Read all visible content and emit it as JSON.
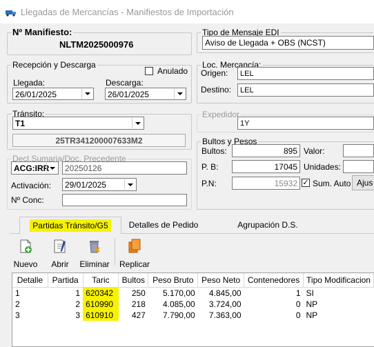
{
  "window": {
    "title": "Llegadas de Mercancías - Manifiestos de Importación"
  },
  "manifest": {
    "label": "Nº Manifiesto:",
    "value": "NLTM2025000976"
  },
  "edi": {
    "label": "Tipo de Mensaje EDI",
    "value": "Aviso de Llegada + OBS (NCST)"
  },
  "reception": {
    "label": "Recepción y Descarga",
    "anulado_label": "Anulado",
    "llegada_label": "Llegada:",
    "llegada_value": "26/01/2025",
    "descarga_label": "Descarga:",
    "descarga_value": "26/01/2025"
  },
  "loc": {
    "label": "Loc. Mercancía:",
    "origen_label": "Origen:",
    "origen_value": "LEL",
    "destino_label": "Destino:",
    "destino_value": "LEL"
  },
  "transito": {
    "label": "Tránsito:",
    "type_value": "T1",
    "code_value": "25TR341200007633M2"
  },
  "expedidor": {
    "label": "Expedidor",
    "value": "1Y"
  },
  "decl": {
    "label": "Decl.Sumaria/Doc. Precedente",
    "type_value": "ACG:IRR",
    "number_value": "20250126",
    "activacion_label": "Activación:",
    "activacion_value": "29/01/2025",
    "conc_label": "Nº Conc:",
    "conc_value": ""
  },
  "bultos": {
    "label": "Bultos y Pesos",
    "bultos_label": "Bultos:",
    "bultos_value": "895",
    "pb_label": "P. B:",
    "pb_value": "17045",
    "pn_label": "P.N:",
    "pn_value": "15932",
    "valor_label": "Valor:",
    "unidades_label": "Unidades:",
    "sum_auto_label": "Sum. Auto",
    "ajus_label": "Ajus"
  },
  "tabs": [
    "Partidas Tránsito/G5",
    "Detalles de Pedido",
    "Agrupación D.S."
  ],
  "toolbar": {
    "nuevo": "Nuevo",
    "abrir": "Abrir",
    "eliminar": "Eliminar",
    "replicar": "Replicar"
  },
  "table": {
    "headers": [
      "Detalle",
      "Partida",
      "Taric",
      "Bultos",
      "Peso Bruto",
      "Peso Neto",
      "Contenedores",
      "Tipo Modificacion"
    ],
    "rows": [
      [
        "1",
        "1",
        "620342",
        "250",
        "5.170,00",
        "4.845,00",
        "1",
        "SI"
      ],
      [
        "2",
        "2",
        "610990",
        "218",
        "4.085,00",
        "3.724,00",
        "0",
        "NP"
      ],
      [
        "3",
        "3",
        "610910",
        "427",
        "7.790,00",
        "7.363,00",
        "0",
        "NP"
      ]
    ]
  },
  "colors": {
    "highlight": "#f7f200",
    "border": "#c8c8c8"
  }
}
